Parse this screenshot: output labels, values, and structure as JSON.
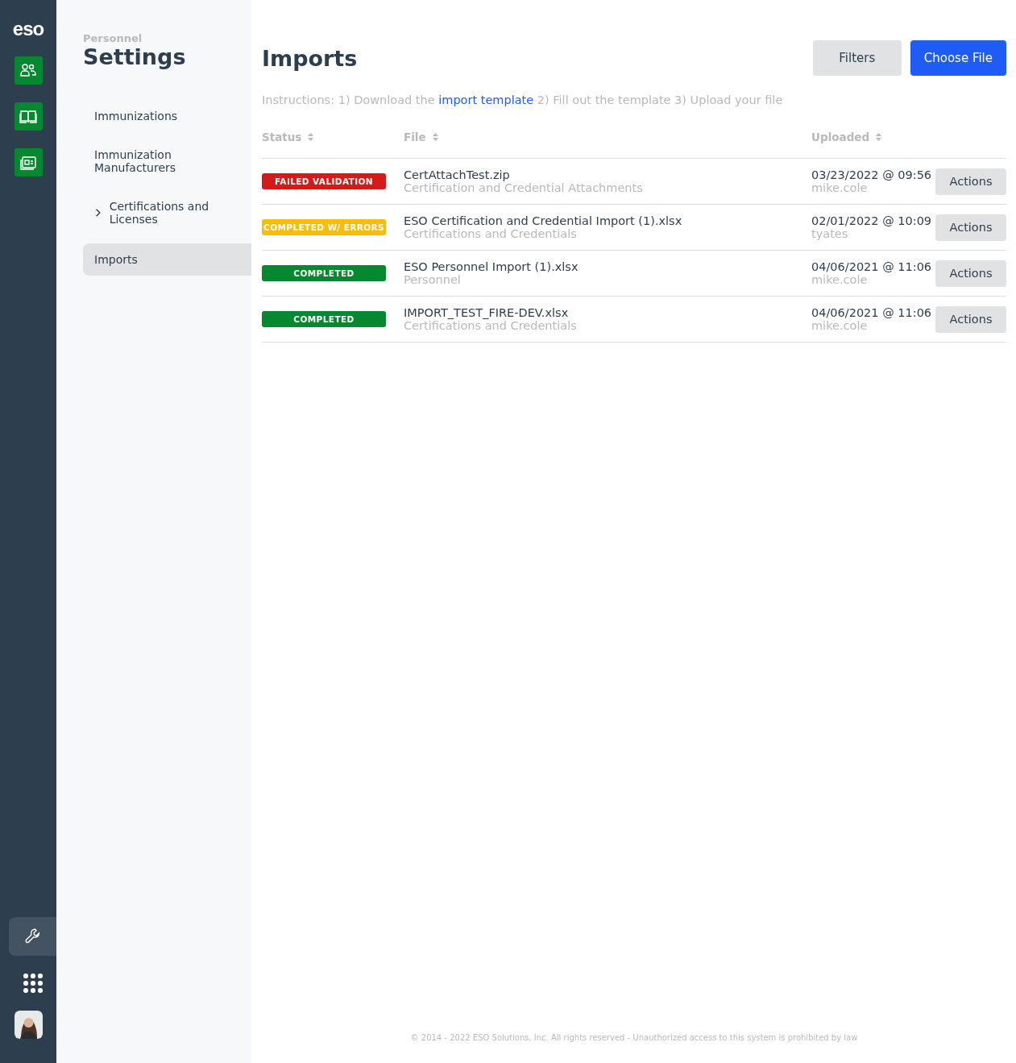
{
  "rail": {
    "logo": "eso",
    "apps": [
      {
        "kind": "people",
        "selected": false
      },
      {
        "kind": "book",
        "selected": false
      },
      {
        "kind": "news",
        "selected": false
      }
    ],
    "tools": [
      {
        "kind": "wrench",
        "selected": true
      },
      {
        "kind": "grid",
        "selected": false
      },
      {
        "kind": "avatar",
        "selected": false
      }
    ]
  },
  "sidebar": {
    "module": "Personnel",
    "title": "Settings",
    "items": [
      {
        "label": "Immunizations",
        "selected": false
      },
      {
        "label": "Immunization Manufacturers",
        "selected": false
      },
      {
        "label": "Certifications and Licenses",
        "selected": false,
        "expanded": false
      },
      {
        "label": "Imports",
        "selected": true
      }
    ]
  },
  "header": {
    "title": "Imports",
    "buttons": [
      {
        "label": "Filters",
        "kind": "secondary"
      },
      {
        "label": "Choose File",
        "kind": "primary"
      }
    ]
  },
  "instructions": {
    "before": "Instructions: 1) Download the",
    "link": "import template",
    "after": "2) Fill out the template 3) Upload your file"
  },
  "table": {
    "columns": [
      "Status",
      "File",
      "Uploaded"
    ],
    "rows": [
      {
        "status": "FAILED VALIDATION",
        "kind": "failed",
        "file": "CertAttachTest.zip",
        "type": "Certification and Credential Attachments",
        "date": "03/23/2022 @ 09:56",
        "user": "mike.cole",
        "action": "Actions"
      },
      {
        "status": "COMPLETED W/ ERRORS",
        "kind": "warning",
        "file": "ESO Certification and Credential Import (1).xlsx",
        "type": "Certifications and Credentials",
        "date": "02/01/2022 @ 10:09",
        "user": "tyates",
        "action": "Actions"
      },
      {
        "status": "COMPLETED",
        "kind": "success",
        "file": "ESO Personnel Import (1).xlsx",
        "type": "Personnel",
        "date": "04/06/2021 @ 11:06",
        "user": "mike.cole",
        "action": "Actions"
      },
      {
        "status": "COMPLETED",
        "kind": "success",
        "file": "IMPORT_TEST_FIRE-DEV.xlsx",
        "type": "Certifications and Credentials",
        "date": "04/06/2021 @ 11:06",
        "user": "mike.cole",
        "action": "Actions"
      }
    ]
  },
  "footer": "© 2014 - 2022 ESO Solutions, Inc. All rights reserved - Unauthorized access to this system is prohibited by law"
}
